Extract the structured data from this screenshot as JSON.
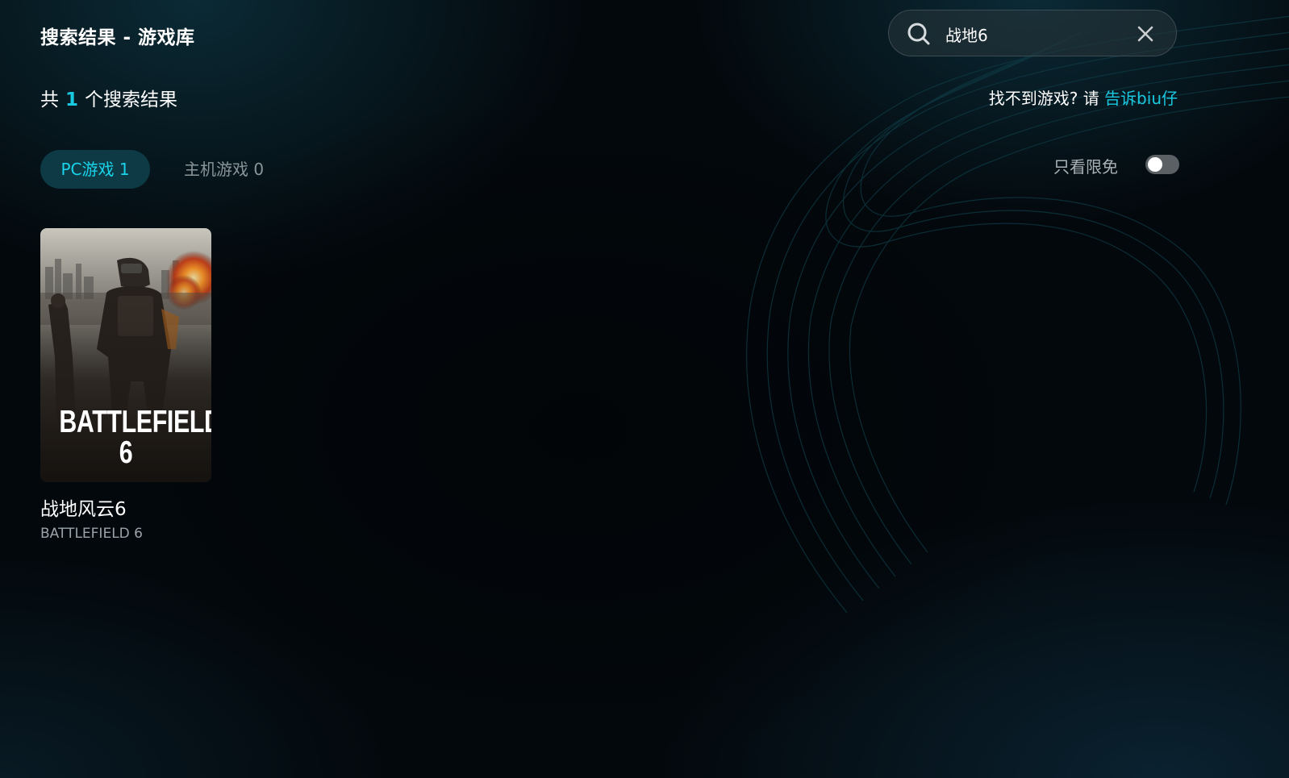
{
  "header": {
    "title": "搜索结果 - 游戏库"
  },
  "search": {
    "value": "战地6",
    "icon": "search-icon",
    "clear_icon": "close-icon"
  },
  "results": {
    "prefix": "共",
    "count": "1",
    "suffix": "个搜索结果"
  },
  "feedback": {
    "text": "找不到游戏? 请",
    "link": "告诉biu仔"
  },
  "tabs": [
    {
      "label": "PC游戏 1",
      "active": true
    },
    {
      "label": "主机游戏 0",
      "active": false
    }
  ],
  "filter": {
    "label": "只看限免",
    "enabled": false
  },
  "games": [
    {
      "title_zh": "战地风云6",
      "title_en": "BATTLEFIELD 6",
      "cover_logo_line1": "BATTLEFIELD",
      "cover_logo_tm": "™",
      "cover_logo_line2": "6"
    }
  ],
  "colors": {
    "accent": "#19c9e0",
    "tab_active_bg": "#0d3a44",
    "background": "#03080c"
  }
}
